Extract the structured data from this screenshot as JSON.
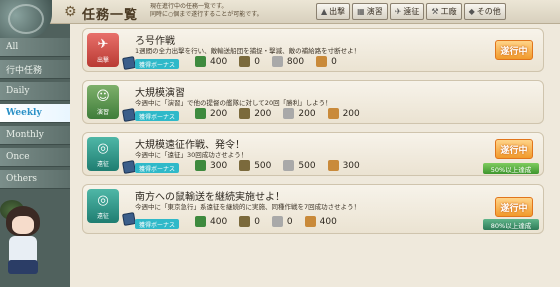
{
  "header": {
    "title": "任務一覧",
    "subtitle": "現在進行中の任務一覧です。\n同時に○個まで遂行することが可能です。",
    "filters": [
      {
        "label": "出撃",
        "icon": "sortie-icon"
      },
      {
        "label": "演習",
        "icon": "exercise-icon"
      },
      {
        "label": "遠征",
        "icon": "expedition-icon"
      },
      {
        "label": "工廠",
        "icon": "arsenal-icon"
      },
      {
        "label": "その他",
        "icon": "other-icon"
      }
    ]
  },
  "sidebar": {
    "tabs": [
      {
        "label": "All"
      },
      {
        "label": "行中任務"
      },
      {
        "label": "Daily"
      },
      {
        "label": "Weekly"
      },
      {
        "label": "Monthly"
      },
      {
        "label": "Once"
      },
      {
        "label": "Others"
      }
    ],
    "active": "Weekly"
  },
  "quests": [
    {
      "category": "出撃",
      "category_type": "sortie",
      "name": "ろ号作戦",
      "desc": "1週間の全力出撃を行い、敵輸送船団を捕捉・撃滅、敵の補給路を寸断せよ！",
      "bonus": "獲得ボーナス",
      "rewards": [
        400,
        0,
        800,
        0
      ],
      "status": "遂行中",
      "progress": ""
    },
    {
      "category": "演習",
      "category_type": "exercise",
      "name": "大規模演習",
      "desc": "今週中に「演習」で他の提督の艦隊に対して20回「勝利」しよう！",
      "bonus": "獲得ボーナス",
      "rewards": [
        200,
        200,
        200,
        200
      ],
      "status": "",
      "progress": ""
    },
    {
      "category": "遠征",
      "category_type": "expedition",
      "name": "大規模遠征作戦、発令！",
      "desc": "今週中に「遠征」30回成功させよう！",
      "bonus": "獲得ボーナス",
      "rewards": [
        300,
        500,
        500,
        300
      ],
      "status": "遂行中",
      "progress": "50%以上達成"
    },
    {
      "category": "遠征",
      "category_type": "expedition",
      "name": "南方への鼠輸送を継続実施せよ！",
      "desc": "今週中に「東京急行」系遠征を継続的に実施、同種作戦を7回成功させよう！",
      "bonus": "獲得ボーナス",
      "rewards": [
        400,
        0,
        0,
        400
      ],
      "status": "遂行中",
      "progress": "80%以上達成"
    }
  ],
  "colors": {
    "active_tab_text": "#2a90c6",
    "status_orange": "#f19a2b",
    "progress_green": "#3e962e",
    "bonus_cyan": "#2fb9c9"
  }
}
